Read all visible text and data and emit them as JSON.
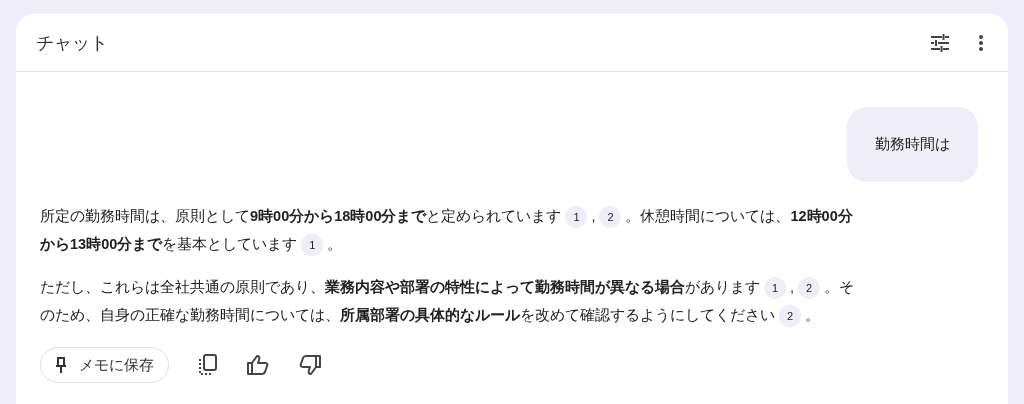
{
  "header": {
    "title": "チャット"
  },
  "user_message": {
    "text": "勤務時間は"
  },
  "answer": {
    "paragraphs": [
      {
        "lines": [
          {
            "segments": [
              {
                "kind": "text",
                "text": "所定の勤務時間は、原則として**9時00分から18時00分まで**と定められています"
              },
              {
                "kind": "cite",
                "label": "1"
              },
              {
                "kind": "text",
                "text": ","
              },
              {
                "kind": "cite",
                "label": "2"
              },
              {
                "kind": "text",
                "text": "。休憩時間については、**12時00分**"
              }
            ]
          },
          {
            "segments": [
              {
                "kind": "text",
                "text": "**から13時00分まで**を基本としています"
              },
              {
                "kind": "cite",
                "label": "1"
              },
              {
                "kind": "text",
                "text": "。"
              }
            ]
          }
        ]
      },
      {
        "lines": [
          {
            "segments": [
              {
                "kind": "text",
                "text": "ただし、これらは全社共通の原則であり、**業務内容や部署の特性によって勤務時間が異なる場合**があります"
              },
              {
                "kind": "cite",
                "label": "1"
              },
              {
                "kind": "text",
                "text": ","
              },
              {
                "kind": "cite",
                "label": "2"
              },
              {
                "kind": "text",
                "text": "。そ"
              }
            ]
          },
          {
            "segments": [
              {
                "kind": "text",
                "text": "のため、自身の正確な勤務時間については、**所属部署の具体的なルール**を改めて確認するようにしてください"
              },
              {
                "kind": "cite",
                "label": "2"
              },
              {
                "kind": "text",
                "text": "。"
              }
            ]
          }
        ]
      }
    ]
  },
  "actions": {
    "save_label": "メモに保存"
  }
}
